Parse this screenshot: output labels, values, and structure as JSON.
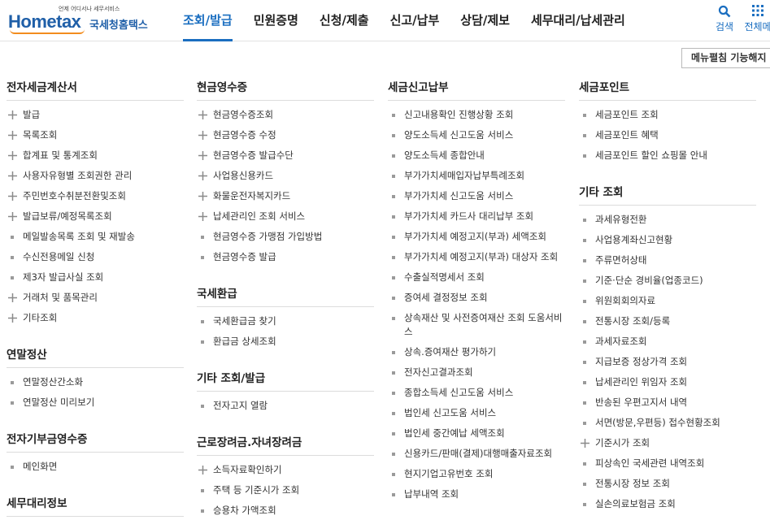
{
  "header": {
    "logo_sub": "언제 어디서나 세무서비스",
    "logo_text": "Hometax",
    "logo_kr": "국세청홈택스",
    "nav": [
      "조회/발급",
      "민원증명",
      "신청/제출",
      "신고/납부",
      "상담/제보",
      "세무대리/납세관리"
    ],
    "active_nav": 0,
    "search_label": "검색",
    "all_label": "전체메"
  },
  "collapse_button": "메뉴펼침 기능해지",
  "columns": [
    {
      "sections": [
        {
          "title": "전자세금계산서",
          "items": [
            {
              "label": "발급",
              "icon": "plus"
            },
            {
              "label": "목록조회",
              "icon": "plus"
            },
            {
              "label": "합계표 및 통계조회",
              "icon": "plus"
            },
            {
              "label": "사용자유형별 조회권한 관리",
              "icon": "plus"
            },
            {
              "label": "주민번호수취분전환및조회",
              "icon": "plus"
            },
            {
              "label": "발급보류/예정목록조회",
              "icon": "plus"
            },
            {
              "label": "메일발송목록 조회 및 재발송",
              "icon": "dot"
            },
            {
              "label": "수신전용메일 신청",
              "icon": "dot"
            },
            {
              "label": "제3자 발급사실 조회",
              "icon": "dot"
            },
            {
              "label": "거래처 및 품목관리",
              "icon": "plus"
            },
            {
              "label": "기타조회",
              "icon": "plus"
            }
          ]
        },
        {
          "title": "연말정산",
          "items": [
            {
              "label": "연말정산간소화",
              "icon": "dot"
            },
            {
              "label": "연말정산 미리보기",
              "icon": "dot"
            }
          ]
        },
        {
          "title": "전자기부금영수증",
          "items": [
            {
              "label": "메인화면",
              "icon": "dot"
            }
          ]
        },
        {
          "title": "세무대리정보",
          "items": []
        }
      ]
    },
    {
      "sections": [
        {
          "title": "현금영수증",
          "items": [
            {
              "label": "현금영수증조회",
              "icon": "plus"
            },
            {
              "label": "현금영수증 수정",
              "icon": "plus"
            },
            {
              "label": "현금영수증 발급수단",
              "icon": "plus"
            },
            {
              "label": "사업용신용카드",
              "icon": "plus"
            },
            {
              "label": "화물운전자복지카드",
              "icon": "plus"
            },
            {
              "label": "납세관리인 조회 서비스",
              "icon": "plus"
            },
            {
              "label": "현금영수증 가맹점 가입방법",
              "icon": "dot"
            },
            {
              "label": "현금영수증 발급",
              "icon": "dot"
            }
          ]
        },
        {
          "title": "국세환급",
          "items": [
            {
              "label": "국세환급금 찾기",
              "icon": "dot"
            },
            {
              "label": "환급금 상세조회",
              "icon": "dot"
            }
          ]
        },
        {
          "title": "기타 조회/발급",
          "items": [
            {
              "label": "전자고지 열람",
              "icon": "dot"
            }
          ]
        },
        {
          "title": "근로장려금.자녀장려금",
          "items": [
            {
              "label": "소득자료확인하기",
              "icon": "plus"
            },
            {
              "label": "주택 등 기준시가 조회",
              "icon": "dot"
            },
            {
              "label": "승용차 가액조회",
              "icon": "dot"
            }
          ]
        }
      ]
    },
    {
      "sections": [
        {
          "title": "세금신고납부",
          "items": [
            {
              "label": "신고내용확인 진행상황 조회",
              "icon": "dot"
            },
            {
              "label": "양도소득세 신고도움 서비스",
              "icon": "dot"
            },
            {
              "label": "양도소득세 종합안내",
              "icon": "dot"
            },
            {
              "label": "부가가치세매입자납부특례조회",
              "icon": "dot"
            },
            {
              "label": "부가가치세 신고도움 서비스",
              "icon": "dot"
            },
            {
              "label": "부가가치세 카드사 대리납부 조회",
              "icon": "dot"
            },
            {
              "label": "부가가치세 예정고지(부과) 세액조회",
              "icon": "dot"
            },
            {
              "label": "부가가치세 예정고지(부과) 대상자 조회",
              "icon": "dot"
            },
            {
              "label": "수출실적명세서 조회",
              "icon": "dot"
            },
            {
              "label": "증여세 결정정보 조회",
              "icon": "dot"
            },
            {
              "label": "상속재산 및 사전증여재산 조회 도움서비스",
              "icon": "dot"
            },
            {
              "label": "상속.증여재산 평가하기",
              "icon": "dot"
            },
            {
              "label": "전자신고결과조회",
              "icon": "dot"
            },
            {
              "label": "종합소득세 신고도움 서비스",
              "icon": "dot"
            },
            {
              "label": "법인세 신고도움 서비스",
              "icon": "dot"
            },
            {
              "label": "법인세 중간예납 세액조회",
              "icon": "dot"
            },
            {
              "label": "신용카드/판매(결제)대행매출자료조회",
              "icon": "dot"
            },
            {
              "label": "현지기업고유번호 조회",
              "icon": "dot"
            },
            {
              "label": "납부내역 조회",
              "icon": "dot"
            }
          ]
        }
      ]
    },
    {
      "sections": [
        {
          "title": "세금포인트",
          "items": [
            {
              "label": "세금포인트 조회",
              "icon": "dot"
            },
            {
              "label": "세금포인트 혜택",
              "icon": "dot"
            },
            {
              "label": "세금포인트 할인 쇼핑몰 안내",
              "icon": "dot"
            }
          ]
        },
        {
          "title": "기타 조회",
          "items": [
            {
              "label": "과세유형전환",
              "icon": "dot"
            },
            {
              "label": "사업용계좌신고현황",
              "icon": "dot"
            },
            {
              "label": "주류면허상태",
              "icon": "dot"
            },
            {
              "label": "기준·단순 경비율(업종코드)",
              "icon": "dot"
            },
            {
              "label": "위원회회의자료",
              "icon": "dot"
            },
            {
              "label": "전통시장 조회/등록",
              "icon": "dot"
            },
            {
              "label": "과세자료조회",
              "icon": "dot"
            },
            {
              "label": "지급보증 정상가격 조회",
              "icon": "dot"
            },
            {
              "label": "납세관리인 위임자 조회",
              "icon": "dot"
            },
            {
              "label": "반송된 우편고지서 내역",
              "icon": "dot"
            },
            {
              "label": "서면(방문,우편등) 접수현황조회",
              "icon": "dot"
            },
            {
              "label": "기준시가 조회",
              "icon": "plus"
            },
            {
              "label": "피상속인 국세관련 내역조회",
              "icon": "dot"
            },
            {
              "label": "전통시장 정보 조회",
              "icon": "dot"
            },
            {
              "label": "실손의료보험금 조회",
              "icon": "dot"
            }
          ]
        }
      ]
    }
  ]
}
